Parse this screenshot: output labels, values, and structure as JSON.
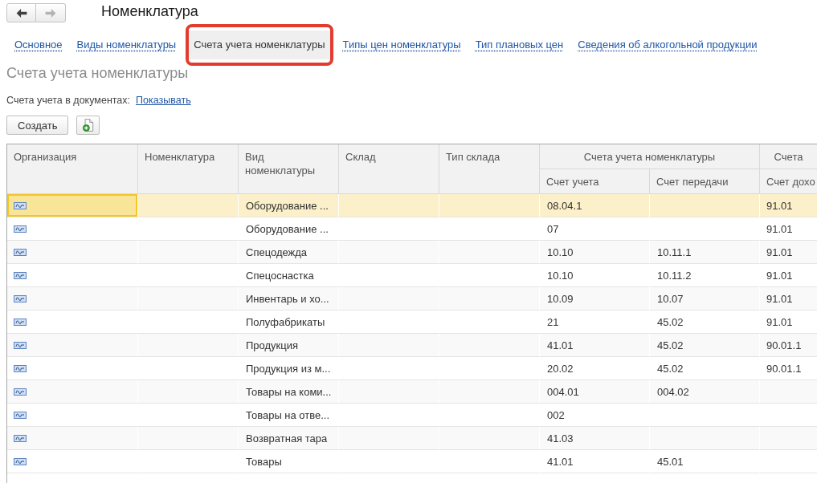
{
  "nav": {
    "back": {
      "disabled": false
    },
    "forward": {
      "disabled": true
    }
  },
  "title": "Номенклатура",
  "tabs": [
    {
      "label": "Основное",
      "selected": false,
      "highlighted": false
    },
    {
      "label": "Виды номенклатуры",
      "selected": false,
      "highlighted": false
    },
    {
      "label": "Счета учета номенклатуры",
      "selected": true,
      "highlighted": true
    },
    {
      "label": "Типы цен номенклатуры",
      "selected": false,
      "highlighted": false
    },
    {
      "label": "Тип плановых цен",
      "selected": false,
      "highlighted": false
    },
    {
      "label": "Сведения об алкогольной продукции",
      "selected": false,
      "highlighted": false
    }
  ],
  "heading": "Счета учета номенклатуры",
  "accounts_in_documents": {
    "label": "Счета учета в документах:",
    "link": "Показывать"
  },
  "toolbar": {
    "create_button": "Создать"
  },
  "table": {
    "header": [
      {
        "label": "Организация"
      },
      {
        "label": "Номенклатура"
      },
      {
        "label": "Вид номенклатуры"
      },
      {
        "label": "Склад"
      },
      {
        "label": "Тип склада"
      },
      {
        "label": "Счета учета номенклатуры",
        "children": [
          {
            "label": "Счет учета"
          },
          {
            "label": "Счет передачи"
          }
        ]
      },
      {
        "label": "Счета",
        "children": [
          {
            "label": "Счет дохо"
          }
        ]
      }
    ],
    "rows": [
      {
        "selected": true,
        "nomenclature_type": "Оборудование ...",
        "account": "08.04.1",
        "column_8": "91.01"
      },
      {
        "selected": false,
        "nomenclature_type": "Оборудование ...",
        "account": "07",
        "column_8": "91.01"
      },
      {
        "selected": false,
        "nomenclature_type": "Спецодежда",
        "account": "10.10",
        "transfer_account": "10.11.1",
        "column_8": "91.01"
      },
      {
        "selected": false,
        "nomenclature_type": "Спецоснастка",
        "account": "10.10",
        "transfer_account": "10.11.2",
        "column_8": "91.01"
      },
      {
        "selected": false,
        "nomenclature_type": "Инвентарь и хо...",
        "account": "10.09",
        "transfer_account": "10.07",
        "column_8": "91.01"
      },
      {
        "selected": false,
        "nomenclature_type": "Полуфабрикаты",
        "account": "21",
        "transfer_account": "45.02",
        "column_8": "91.01"
      },
      {
        "selected": false,
        "nomenclature_type": "Продукция",
        "account": "41.01",
        "transfer_account": "45.02",
        "column_8": "90.01.1"
      },
      {
        "selected": false,
        "nomenclature_type": "Продукция из м...",
        "account": "20.02",
        "transfer_account": "45.02",
        "column_8": "90.01.1"
      },
      {
        "selected": false,
        "nomenclature_type": "Товары на коми...",
        "account": "004.01",
        "transfer_account": "004.02"
      },
      {
        "selected": false,
        "nomenclature_type": "Товары на отве...",
        "account": "002"
      },
      {
        "selected": false,
        "nomenclature_type": "Возвратная тара",
        "account": "41.03"
      },
      {
        "selected": false,
        "nomenclature_type": "Товары",
        "account": "41.01",
        "transfer_account": "45.01"
      }
    ]
  }
}
